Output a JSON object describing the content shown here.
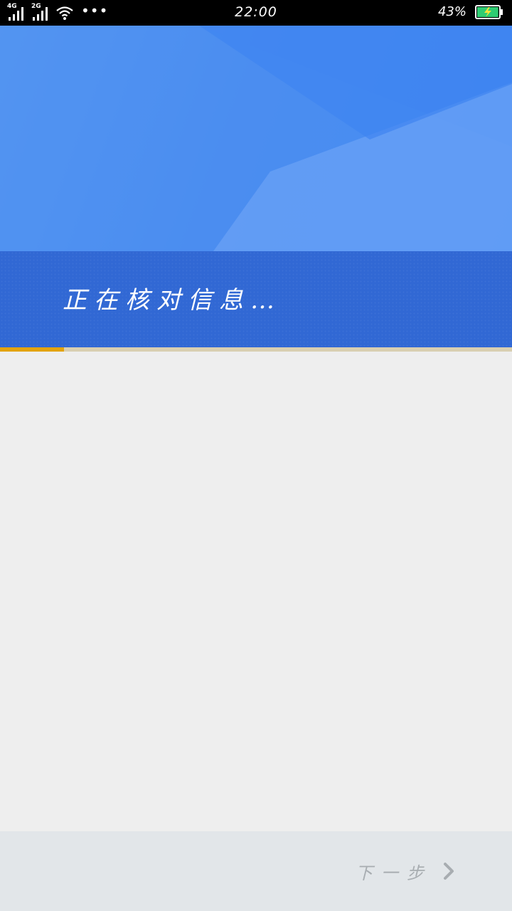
{
  "status_bar": {
    "network_1": "4G",
    "network_2": "2G",
    "more_dots": "•••",
    "time": "22:00",
    "battery_percent": "43%",
    "battery_level": 0.43
  },
  "header": {
    "verifying_text": "正在核对信息…"
  },
  "progress": {
    "value": 0.125,
    "color": "#e3a30f"
  },
  "footer": {
    "next_label": "下一步"
  },
  "colors": {
    "header_blue": "#4a8bf0",
    "band_blue": "#3168d4",
    "content_bg": "#eeeeee",
    "footer_bg": "#e2e6e9"
  }
}
